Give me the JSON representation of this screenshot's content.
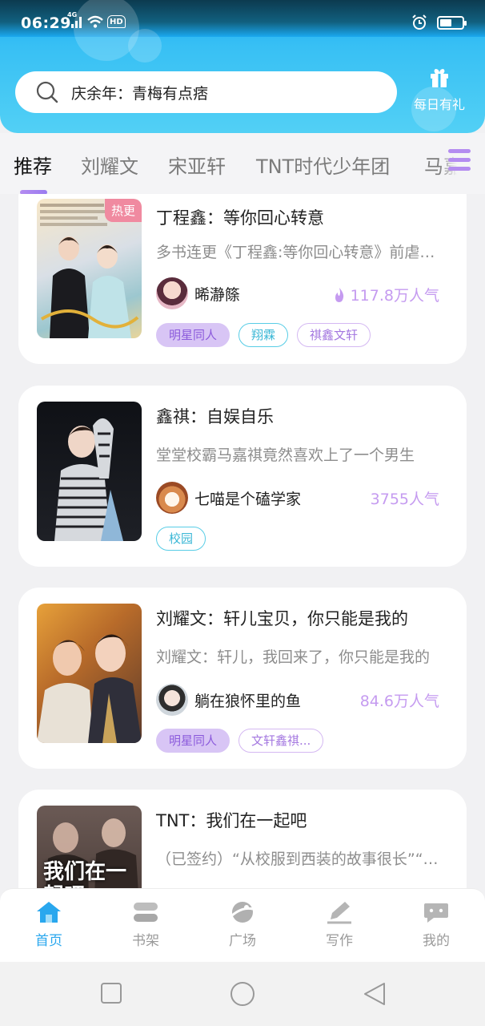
{
  "status_bar": {
    "time": "06:29",
    "network": "4G",
    "hd": "HD"
  },
  "search": {
    "text": "庆余年：青梅有点痞"
  },
  "gift": {
    "label": "每日有礼"
  },
  "tabs": [
    {
      "label": "推荐",
      "active": true
    },
    {
      "label": "刘耀文",
      "active": false
    },
    {
      "label": "宋亚轩",
      "active": false
    },
    {
      "label": "TNT时代少年团",
      "active": false
    },
    {
      "label": "马嘉祺",
      "active": false
    }
  ],
  "cards": [
    {
      "title": "丁程鑫：等你回心转意",
      "desc": "多书连更《丁程鑫:等你回心转意》前虐后甜",
      "author": "晞瀞篨",
      "popularity": "117.8万人气",
      "hot_badge": "热更",
      "tags": [
        "明星同人",
        "翔霖",
        "祺鑫文轩"
      ]
    },
    {
      "title": "鑫祺：自娱自乐",
      "desc": "堂堂校霸马嘉祺竟然喜欢上了一个男生",
      "author": "七喵是个磕学家",
      "popularity": "3755人气",
      "tags": [
        "校园"
      ]
    },
    {
      "title": "刘耀文：轩儿宝贝，你只能是我的",
      "desc": "刘耀文：轩儿，我回来了，你只能是我的",
      "author": "躺在狼怀里的鱼",
      "popularity": "84.6万人气",
      "tags": [
        "明星同人",
        "文轩鑫祺..."
      ]
    },
    {
      "title": "TNT：我们在一起吧",
      "desc": "（已签约）“从校服到西装的故事很长”“只要你在",
      "cover_text": "我们在一起吧"
    }
  ],
  "bottom_nav": [
    {
      "label": "首页",
      "active": true,
      "icon": "home-icon"
    },
    {
      "label": "书架",
      "active": false,
      "icon": "bookshelf-icon"
    },
    {
      "label": "广场",
      "active": false,
      "icon": "planet-icon"
    },
    {
      "label": "写作",
      "active": false,
      "icon": "pen-icon"
    },
    {
      "label": "我的",
      "active": false,
      "icon": "chat-icon"
    }
  ],
  "colors": {
    "header_blue": "#38c0f4",
    "accent_purple": "#c59bf0",
    "active_nav": "#29a7ee",
    "hot_badge": "#f08aa0"
  }
}
